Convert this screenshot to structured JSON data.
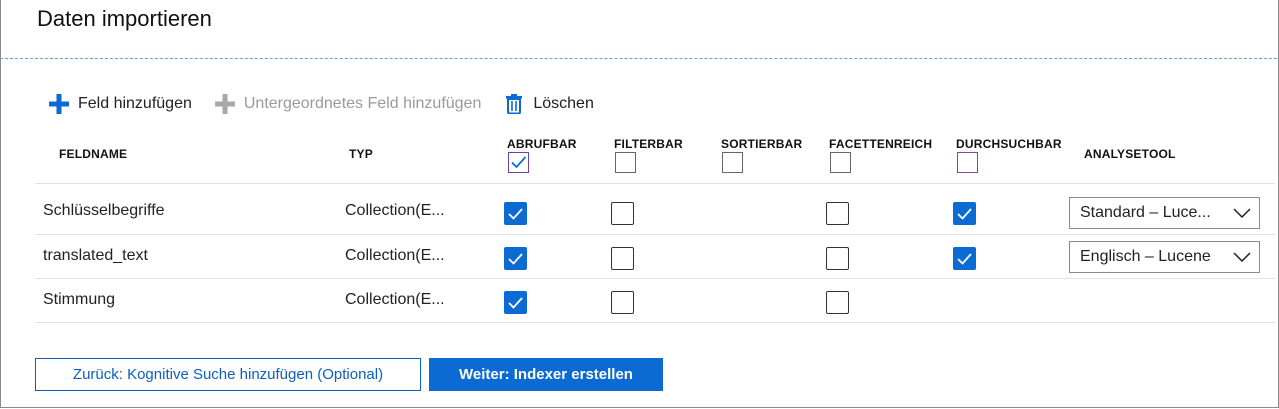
{
  "page": {
    "title": "Daten importieren"
  },
  "toolbar": {
    "add_field": "Feld hinzufügen",
    "add_subfield": "Untergeordnetes Feld hinzufügen",
    "delete": "Löschen"
  },
  "columns": {
    "fieldname": "FELDNAME",
    "type": "TYP",
    "retrievable": "ABRUFBAR",
    "filterable": "FILTERBAR",
    "sortable": "SORTIERBAR",
    "facetable": "FACETTENREICH",
    "searchable": "DURCHSUCHBAR",
    "analyzer": "ANALYSETOOL"
  },
  "header_checks": {
    "retrievable": true,
    "filterable": false,
    "sortable": false,
    "facetable": false,
    "searchable": false
  },
  "rows": [
    {
      "name": "Schlüsselbegriffe",
      "type": "Collection(E...",
      "retrievable": true,
      "filterable": false,
      "facetable": false,
      "searchable": true,
      "analyzer": "Standard – Luce..."
    },
    {
      "name": "translated_text",
      "type": "Collection(E...",
      "retrievable": true,
      "filterable": false,
      "facetable": false,
      "searchable": true,
      "analyzer": "Englisch – Lucene"
    },
    {
      "name": "Stimmung",
      "type": "Collection(E...",
      "retrievable": true,
      "filterable": false,
      "facetable": false
    }
  ],
  "footer": {
    "back_label": "Zurück: Kognitive Suche hinzufügen (Optional)",
    "next_label": "Weiter: Indexer erstellen"
  },
  "colors": {
    "accent": "#0b6bd3",
    "searchable_border": "#8a3fb0",
    "divider": "#5aa5e0"
  }
}
